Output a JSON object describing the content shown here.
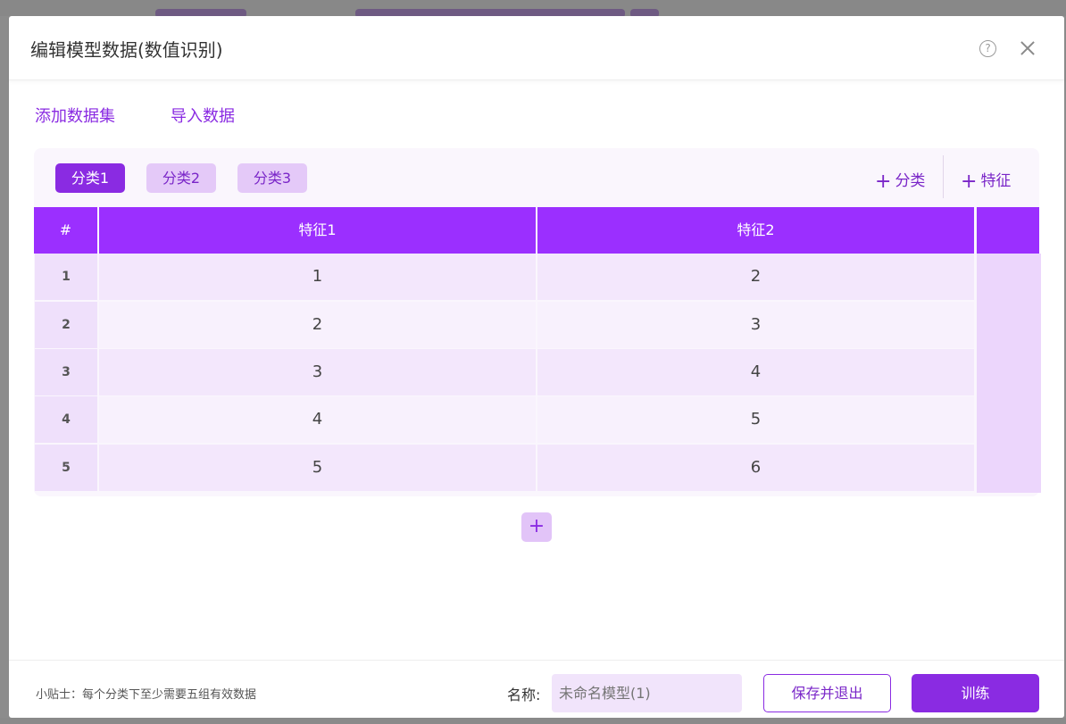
{
  "dialog": {
    "title": "编辑模型数据(数值识别)",
    "help_icon": "question-circle-icon",
    "close_icon": "close-icon"
  },
  "top_links": {
    "add_dataset": "添加数据集",
    "import_data": "导入数据"
  },
  "categories": [
    {
      "label": "分类1",
      "active": true
    },
    {
      "label": "分类2",
      "active": false
    },
    {
      "label": "分类3",
      "active": false
    }
  ],
  "actions": {
    "add_category": "分类",
    "add_feature": "特征",
    "plus_glyph": "+"
  },
  "table": {
    "index_header": "#",
    "columns": [
      "特征1",
      "特征2"
    ],
    "rows": [
      {
        "idx": "1",
        "cells": [
          "1",
          "2"
        ]
      },
      {
        "idx": "2",
        "cells": [
          "2",
          "3"
        ]
      },
      {
        "idx": "3",
        "cells": [
          "3",
          "4"
        ]
      },
      {
        "idx": "4",
        "cells": [
          "4",
          "5"
        ]
      },
      {
        "idx": "5",
        "cells": [
          "5",
          "6"
        ]
      }
    ]
  },
  "add_row_glyph": "+",
  "footer": {
    "tip": "小贴士：每个分类下至少需要五组有效数据",
    "name_label": "名称:",
    "name_placeholder": "未命名模型(1)",
    "save_exit": "保存并退出",
    "train": "训练"
  },
  "colors": {
    "accent": "#8a2be2",
    "header": "#9b2fff",
    "row_odd": "#f3e7fc",
    "row_even": "#f8f1fd"
  }
}
